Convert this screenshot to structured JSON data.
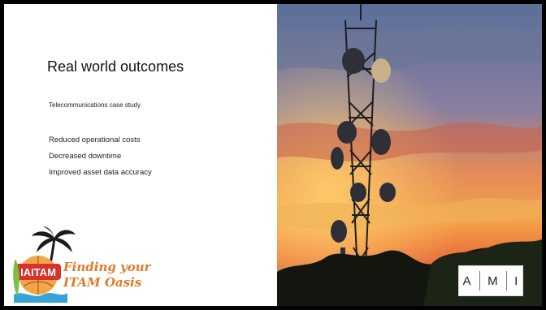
{
  "slide": {
    "title": "Real world outcomes",
    "subtitle": "Telecommunications case study",
    "bullets": [
      "Reduced operational costs",
      "Decreased downtime",
      "Improved asset data accuracy"
    ]
  },
  "event_logo": {
    "badge_text": "IAITAM",
    "tagline_line1": "Finding your",
    "tagline_line2": "ITAM Oasis"
  },
  "brand_logo": {
    "letters": [
      "A",
      "M",
      "I"
    ]
  },
  "photo": {
    "subject": "telecommunications-tower-at-sunset"
  },
  "colors": {
    "frame": "#000000",
    "slide_bg": "#ffffff",
    "tagline": "#e07a2a",
    "badge": "#d7322b"
  }
}
